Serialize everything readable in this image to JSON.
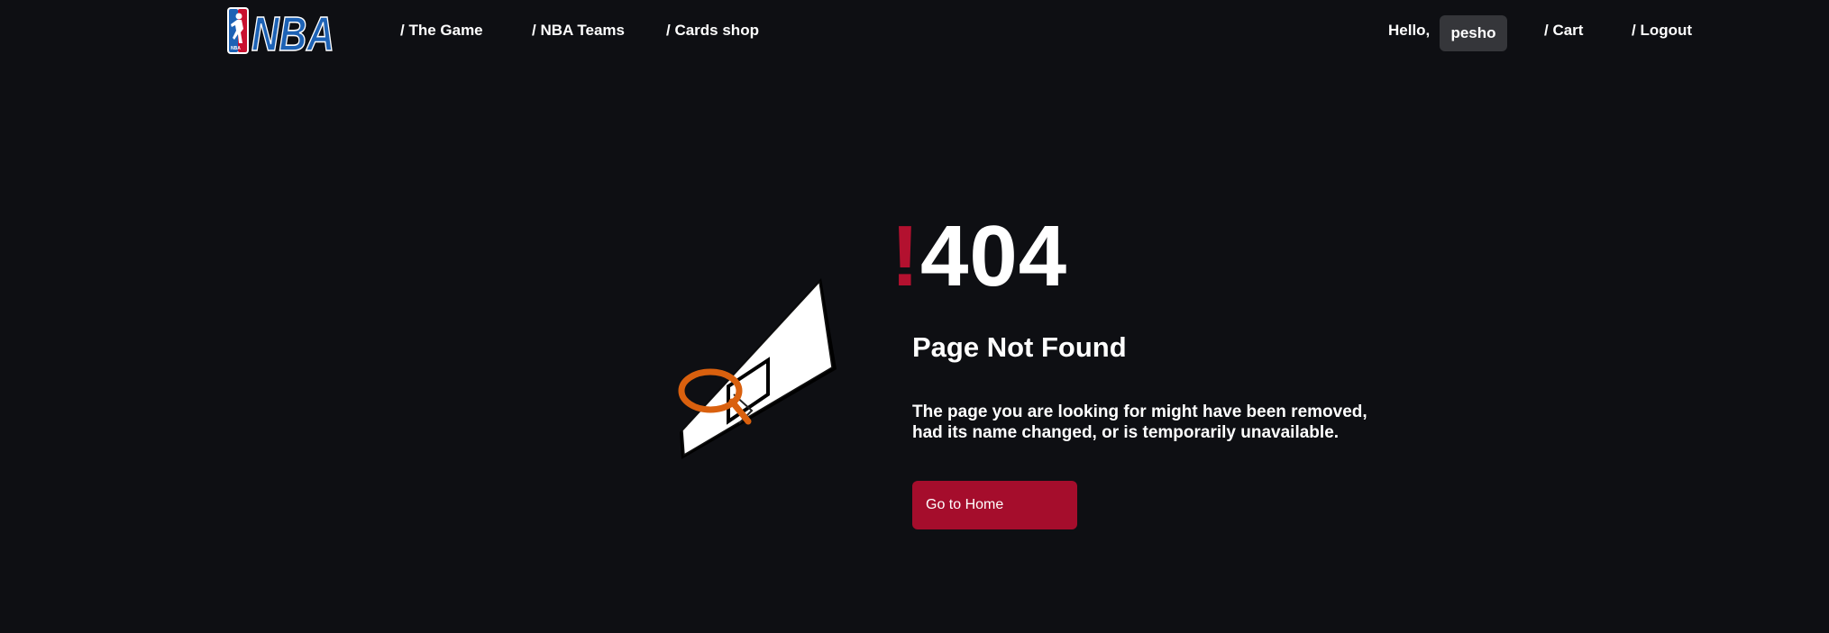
{
  "nav": {
    "logo_text": "NBA",
    "links": [
      {
        "label": "/ The Game"
      },
      {
        "label": "/ NBA Teams"
      },
      {
        "label": "/ Cards shop"
      }
    ],
    "greeting": "Hello,",
    "username": "pesho",
    "cart_label": "/ Cart",
    "logout_label": "/ Logout"
  },
  "error": {
    "exclamation": "!",
    "code": "404",
    "title": "Page Not Found",
    "description": "The page you are looking for might have been removed, had its name changed, or is temporarily unavailable.",
    "button_label": "Go to Home"
  },
  "colors": {
    "background": "#0e0f13",
    "accent": "#b3112f",
    "button": "#a50d2c",
    "user_chip": "#35363a",
    "hoop_rim": "#d9600e",
    "logo_blue": "#1d62b5",
    "logo_red": "#c8102e"
  },
  "icons": {
    "logo": "nba-logo-icon",
    "illustration": "basketball-hoop-icon"
  }
}
